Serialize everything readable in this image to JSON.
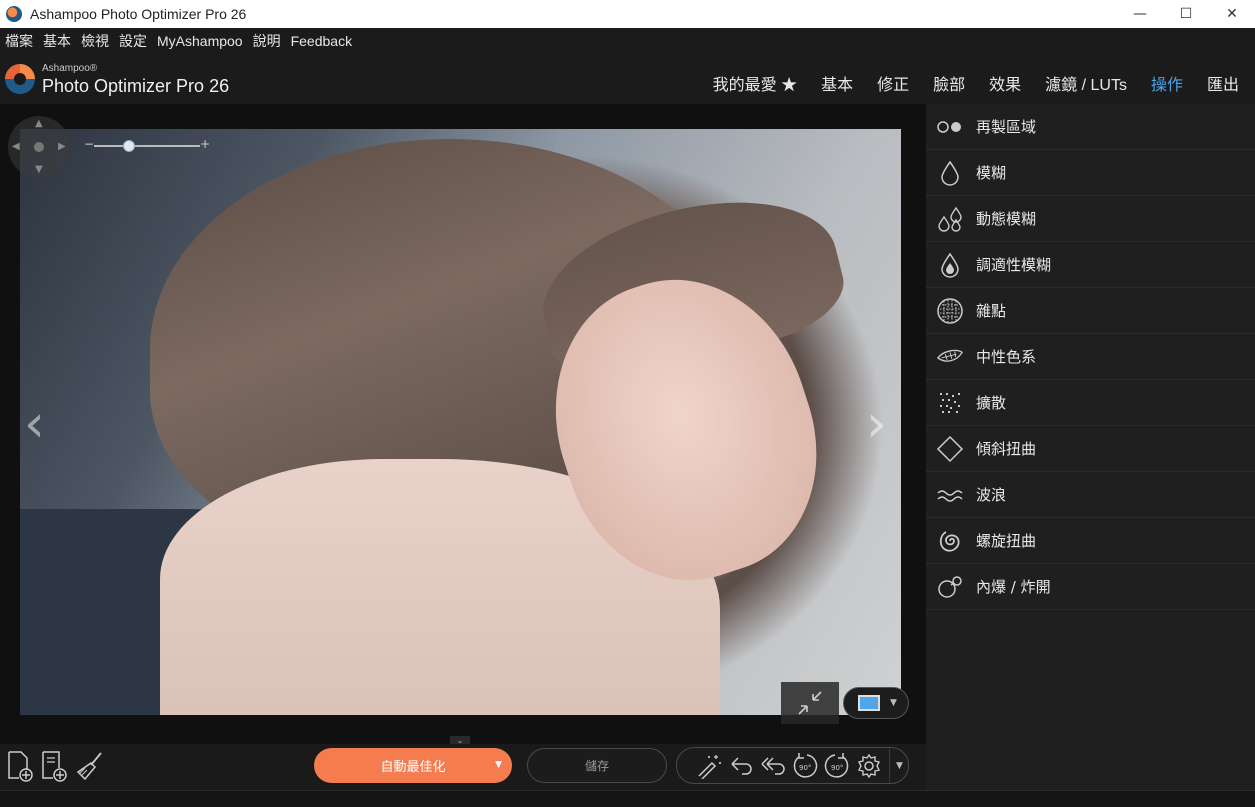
{
  "window": {
    "title": "Ashampoo Photo Optimizer Pro 26",
    "controls": [
      "—",
      "☐",
      "✕"
    ]
  },
  "menu": [
    "檔案",
    "基本",
    "檢視",
    "設定",
    "MyAshampoo",
    "說明",
    "Feedback"
  ],
  "brand": {
    "small": "Ashampoo®",
    "name": "Photo Optimizer Pro 26"
  },
  "nav": [
    {
      "label": "我的最愛 ★",
      "active": false
    },
    {
      "label": "基本",
      "active": false
    },
    {
      "label": "修正",
      "active": false
    },
    {
      "label": "臉部",
      "active": false
    },
    {
      "label": "效果",
      "active": false
    },
    {
      "label": "濾鏡 / LUTs",
      "active": false
    },
    {
      "label": "操作",
      "active": true
    },
    {
      "label": "匯出",
      "active": false
    }
  ],
  "accent_color": "#4aa3e8",
  "zoom": {
    "minus": "−",
    "plus": "+",
    "level_fraction": 0.33
  },
  "panel_items": [
    {
      "label": "再製區域",
      "icon": "clone-icon"
    },
    {
      "label": "模糊",
      "icon": "drop-icon"
    },
    {
      "label": "動態模糊",
      "icon": "motion-drops-icon"
    },
    {
      "label": "調適性模糊",
      "icon": "adaptive-drop-icon"
    },
    {
      "label": "雜點",
      "icon": "noise-grid-icon"
    },
    {
      "label": "中性色系",
      "icon": "feather-icon"
    },
    {
      "label": "擴散",
      "icon": "diffuse-icon"
    },
    {
      "label": "傾斜扭曲",
      "icon": "diamond-icon"
    },
    {
      "label": "波浪",
      "icon": "waves-icon"
    },
    {
      "label": "螺旋扭曲",
      "icon": "swirl-icon"
    },
    {
      "label": "內爆 / 炸開",
      "icon": "bulge-icon"
    }
  ],
  "bottom": {
    "auto_optimize": "自動最佳化",
    "save": "儲存",
    "auto_color": "#f47c4f"
  }
}
